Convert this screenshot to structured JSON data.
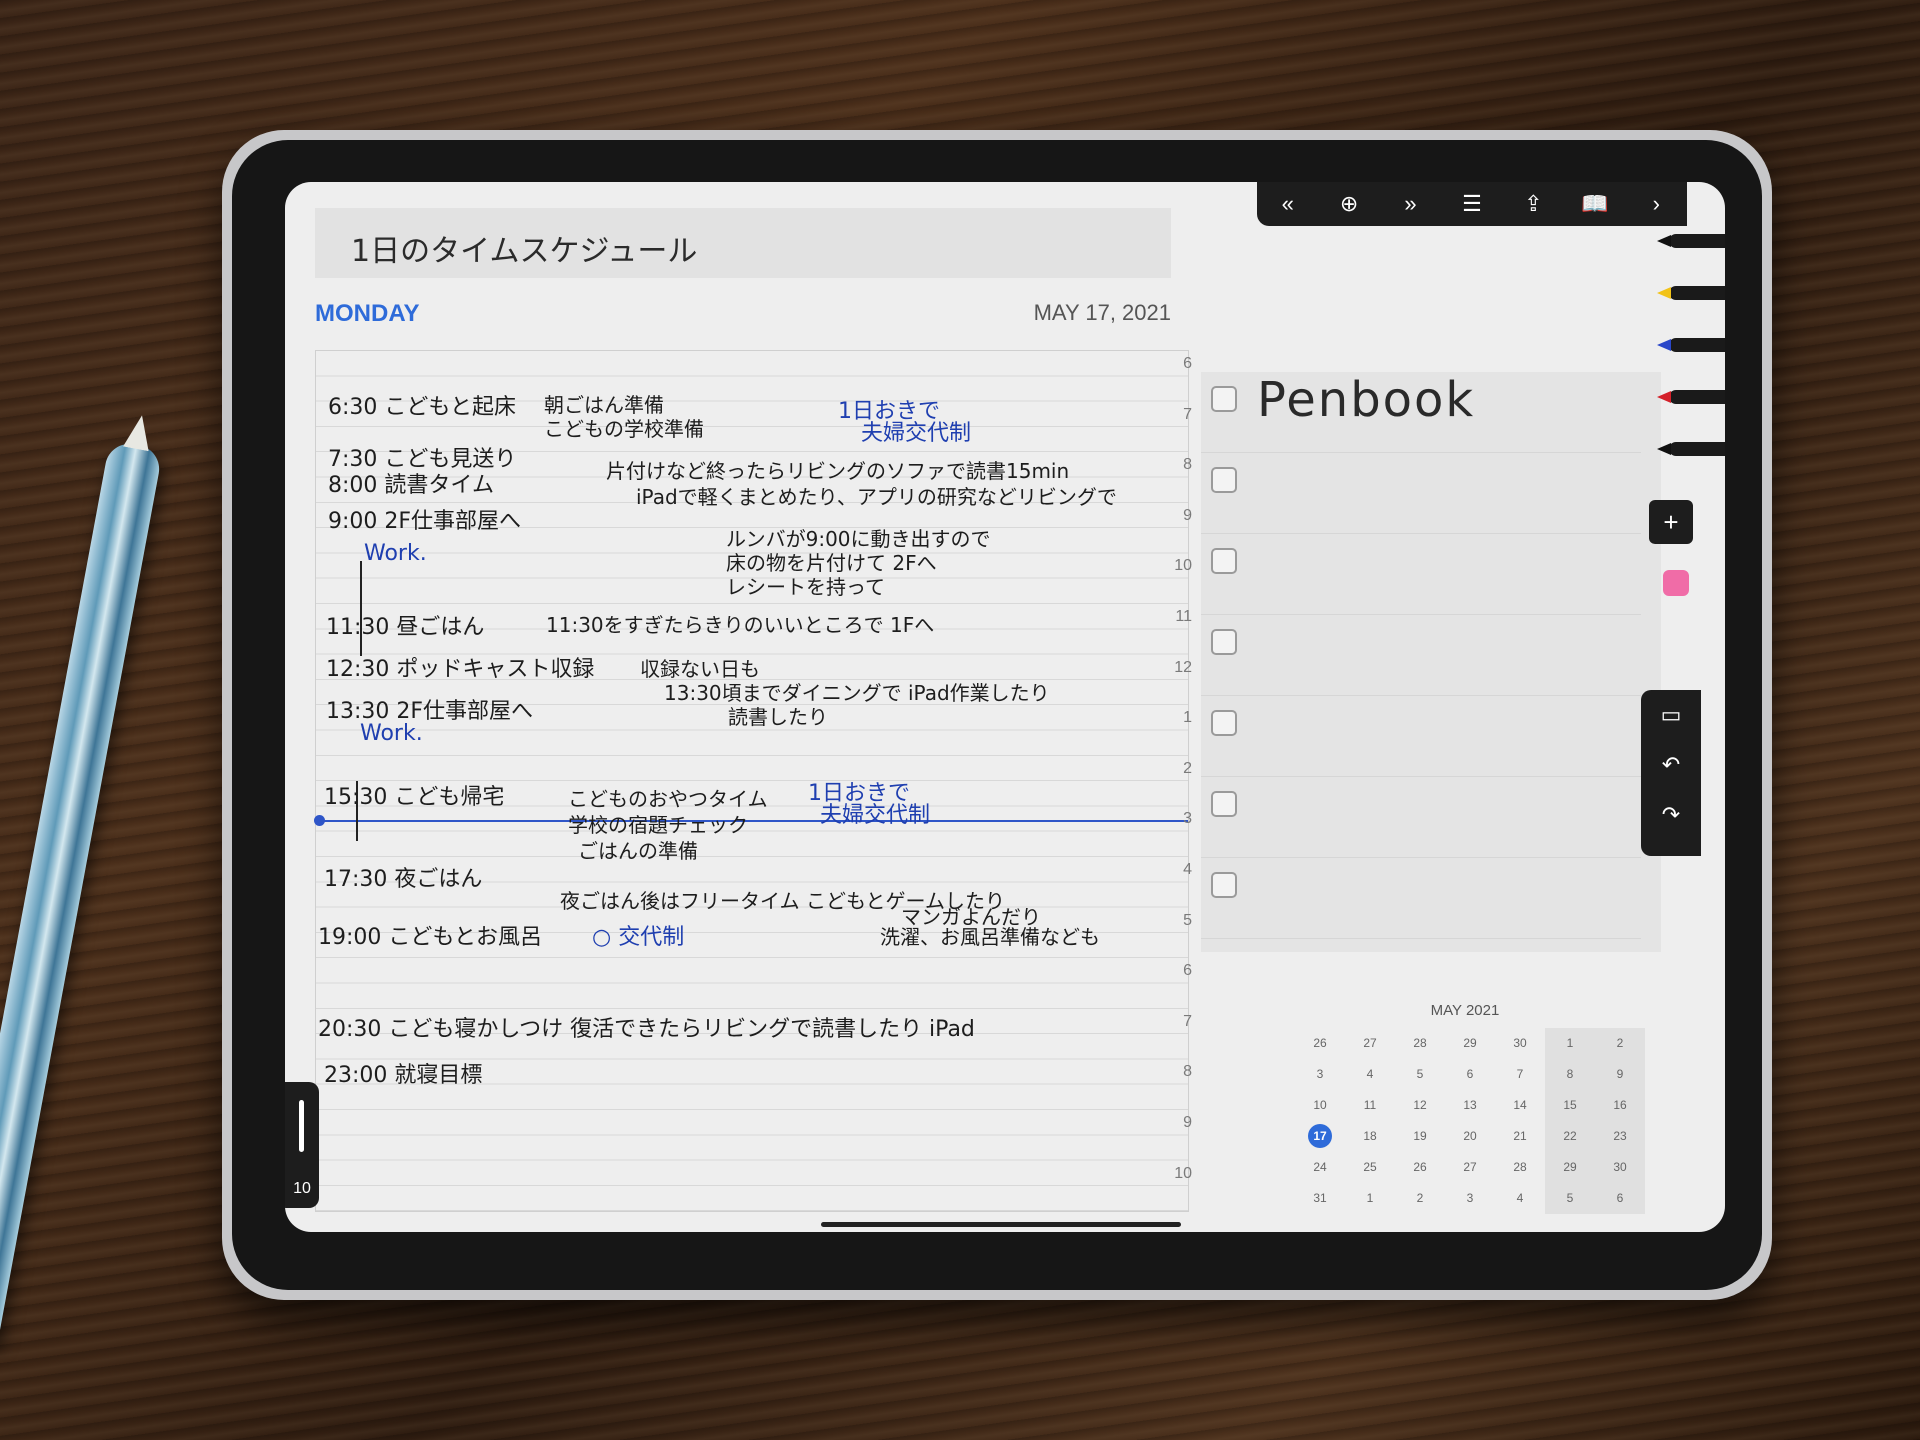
{
  "planner": {
    "title": "1日のタイムスケジュール",
    "day": "MONDAY",
    "date": "MAY 17, 2021",
    "hour_labels": [
      "6",
      "7",
      "8",
      "9",
      "10",
      "11",
      "12",
      "1",
      "2",
      "3",
      "4",
      "5",
      "6",
      "7",
      "8",
      "9",
      "10"
    ],
    "entries": [
      {
        "text": "6:30 こどもと起床",
        "kind": "time"
      },
      {
        "text": "朝ごはん準備",
        "kind": "note"
      },
      {
        "text": "こどもの学校準備",
        "kind": "note"
      },
      {
        "text": "1日おきで",
        "kind": "blue"
      },
      {
        "text": "夫婦交代制",
        "kind": "blue"
      },
      {
        "text": "7:30 こども見送り",
        "kind": "time"
      },
      {
        "text": "8:00 読書タイム",
        "kind": "time"
      },
      {
        "text": "片付けなど終ったらリビングのソファで読書15min",
        "kind": "note"
      },
      {
        "text": "iPadで軽くまとめたり、アプリの研究などリビングで",
        "kind": "note"
      },
      {
        "text": "9:00 2F仕事部屋へ",
        "kind": "time"
      },
      {
        "text": "Work.",
        "kind": "blue"
      },
      {
        "text": "ルンバが9:00に動き出すので",
        "kind": "note"
      },
      {
        "text": "床の物を片付けて 2Fへ",
        "kind": "note"
      },
      {
        "text": "レシートを持って",
        "kind": "note"
      },
      {
        "text": "11:30 昼ごはん",
        "kind": "time"
      },
      {
        "text": "11:30をすぎたらきりのいいところで 1Fへ",
        "kind": "note"
      },
      {
        "text": "12:30 ポッドキャスト収録",
        "kind": "time"
      },
      {
        "text": "収録ない日も",
        "kind": "note"
      },
      {
        "text": "13:30頃までダイニングで iPad作業したり",
        "kind": "note"
      },
      {
        "text": "読書したり",
        "kind": "note"
      },
      {
        "text": "13:30 2F仕事部屋へ",
        "kind": "time"
      },
      {
        "text": "Work.",
        "kind": "blue"
      },
      {
        "text": "15:30 こども帰宅",
        "kind": "time"
      },
      {
        "text": "こどものおやつタイム",
        "kind": "note"
      },
      {
        "text": "学校の宿題チェック",
        "kind": "note"
      },
      {
        "text": "ごはんの準備",
        "kind": "note"
      },
      {
        "text": "1日おきで",
        "kind": "blue"
      },
      {
        "text": "夫婦交代制",
        "kind": "blue"
      },
      {
        "text": "17:30 夜ごはん",
        "kind": "time"
      },
      {
        "text": "夜ごはん後はフリータイム こどもとゲームしたり",
        "kind": "note"
      },
      {
        "text": "マンガよんだり",
        "kind": "note"
      },
      {
        "text": "19:00 こどもとお風呂",
        "kind": "time"
      },
      {
        "text": "○ 交代制",
        "kind": "blue"
      },
      {
        "text": "洗濯、お風呂準備なども",
        "kind": "note"
      },
      {
        "text": "20:30 こども寝かしつけ 復活できたらリビングで読書したり iPad",
        "kind": "time"
      },
      {
        "text": "23:00 就寝目標",
        "kind": "time"
      }
    ]
  },
  "toolbar": {
    "icons": [
      "chevrons-left-icon",
      "plus-circle-icon",
      "chevrons-right-icon",
      "sliders-icon",
      "share-icon",
      "book-icon",
      "chevron-right-icon"
    ],
    "glyphs": [
      "«",
      "⊕",
      "»",
      "☰",
      "⇪",
      "📖",
      "›"
    ]
  },
  "tasks": {
    "heading": "Penbook",
    "count": 7
  },
  "tools": {
    "pens": [
      {
        "name": "black-pen",
        "color": "#111111"
      },
      {
        "name": "yellow-highlighter",
        "color": "#f2c318"
      },
      {
        "name": "blue-pen",
        "color": "#2a47c9"
      },
      {
        "name": "red-pen",
        "color": "#d4202a"
      },
      {
        "name": "black-pen-2",
        "color": "#111111"
      }
    ],
    "add_label": "+",
    "eraser_color": "#f06ca7"
  },
  "undo_panel": {
    "keyboard": "▭",
    "undo": "↶",
    "redo": "↷"
  },
  "calendar": {
    "title": "MAY 2021",
    "today": "17",
    "days": [
      "26",
      "27",
      "28",
      "29",
      "30",
      "1",
      "2",
      "3",
      "4",
      "5",
      "6",
      "7",
      "8",
      "9",
      "10",
      "11",
      "12",
      "13",
      "14",
      "15",
      "16",
      "17",
      "18",
      "19",
      "20",
      "21",
      "22",
      "23",
      "24",
      "25",
      "26",
      "27",
      "28",
      "29",
      "30",
      "31",
      "1",
      "2",
      "3",
      "4",
      "5",
      "6"
    ]
  },
  "page_indicator": "10"
}
